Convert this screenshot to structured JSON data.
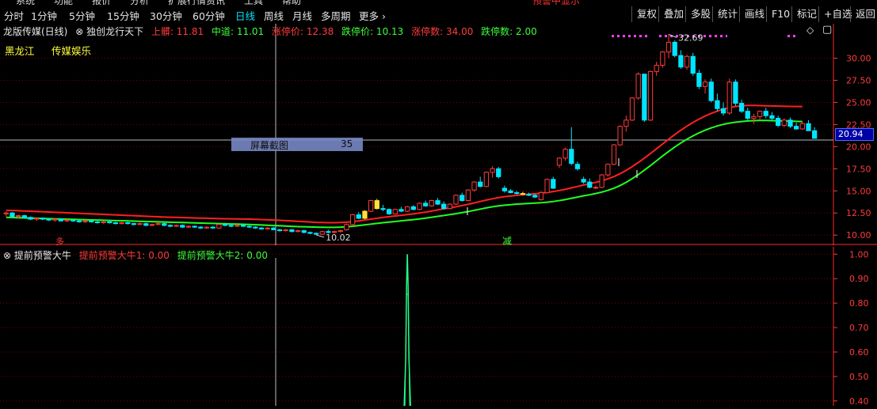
{
  "menu_strip": {
    "items": [
      "系统",
      "功能",
      "报价",
      "分析",
      "扩展行情",
      "资讯",
      "工具",
      "帮助"
    ],
    "alert": "预警中显示"
  },
  "periods": [
    {
      "label": "分时",
      "active": false
    },
    {
      "label": "1分钟",
      "active": false
    },
    {
      "label": "5分钟",
      "active": false
    },
    {
      "label": "15分钟",
      "active": false
    },
    {
      "label": "30分钟",
      "active": false
    },
    {
      "label": "60分钟",
      "active": false
    },
    {
      "label": "日线",
      "active": true
    },
    {
      "label": "周线",
      "active": false
    },
    {
      "label": "月线",
      "active": false
    },
    {
      "label": "多周期",
      "active": false
    },
    {
      "label": "更多 ›",
      "active": false
    }
  ],
  "right_buttons": [
    "复权",
    "叠加",
    "多股",
    "统计",
    "画线",
    "F10",
    "标记",
    "+自选",
    "返回"
  ],
  "main_title": {
    "stock": "龙版传媒(日线)",
    "indicator": "独创龙行天下",
    "upper": "上髒: 11.81",
    "middle": "中道: 11.01",
    "limit_up_price": "涨停价: 12.38",
    "limit_down_price": "跌停价: 10.13",
    "limit_up_count": "涨停数: 34.00",
    "limit_down_count": "跌停数: 2.00"
  },
  "tags": {
    "region": "黑龙江",
    "sector": "传媒娱乐"
  },
  "annotations": {
    "high": "32.69",
    "low": "10.02",
    "jian": "减",
    "mark_red": "多"
  },
  "screenshot_tip": {
    "label": "屏幕截图",
    "value": "35"
  },
  "current_price": "20.94",
  "price_axis": [
    "30.00",
    "27.50",
    "25.00",
    "22.50",
    "20.00",
    "17.50",
    "15.00",
    "12.50",
    "10.00"
  ],
  "indicator_title": {
    "name": "提前预警大牛",
    "line1": "提前预警大牛1: 0.00",
    "line2": "提前预警大牛2: 0.00"
  },
  "indicator_axis": [
    "1.00",
    "0.90",
    "0.80",
    "0.70",
    "0.60",
    "0.50",
    "0.40"
  ],
  "colors": {
    "up": "#ff3b3b",
    "down": "#00e5ff",
    "ma_red": "#ff2020",
    "ma_green": "#22ff22",
    "grid": "#7a0000",
    "magenta": "#ff40ff"
  },
  "chart_data": {
    "type": "candlestick",
    "ylim": [
      9.3,
      33.0
    ],
    "candles": [
      [
        12.4,
        12.7,
        12.1,
        12.5
      ],
      [
        12.5,
        12.6,
        12.0,
        12.1
      ],
      [
        12.1,
        12.3,
        11.9,
        12.2
      ],
      [
        12.2,
        12.3,
        11.9,
        12.0
      ],
      [
        12.0,
        12.1,
        11.7,
        11.8
      ],
      [
        11.8,
        12.0,
        11.6,
        11.9
      ],
      [
        11.9,
        12.0,
        11.7,
        11.8
      ],
      [
        11.8,
        11.9,
        11.6,
        11.7
      ],
      [
        11.7,
        11.9,
        11.5,
        11.8
      ],
      [
        11.8,
        11.9,
        11.6,
        11.6
      ],
      [
        11.6,
        11.8,
        11.5,
        11.7
      ],
      [
        11.7,
        11.8,
        11.5,
        11.6
      ],
      [
        11.6,
        11.7,
        11.4,
        11.5
      ],
      [
        11.5,
        11.7,
        11.4,
        11.6
      ],
      [
        11.6,
        11.7,
        11.4,
        11.5
      ],
      [
        11.5,
        11.6,
        11.3,
        11.4
      ],
      [
        11.4,
        11.6,
        11.3,
        11.5
      ],
      [
        11.5,
        11.7,
        11.3,
        11.4
      ],
      [
        11.4,
        11.5,
        11.2,
        11.3
      ],
      [
        11.3,
        11.5,
        11.2,
        11.4
      ],
      [
        11.4,
        11.5,
        11.2,
        11.3
      ],
      [
        11.3,
        11.4,
        11.1,
        11.2
      ],
      [
        11.2,
        11.4,
        11.1,
        11.3
      ],
      [
        11.3,
        11.4,
        11.0,
        11.1
      ],
      [
        11.1,
        11.3,
        11.0,
        11.2
      ],
      [
        11.2,
        11.4,
        11.1,
        11.3
      ],
      [
        11.3,
        11.4,
        11.0,
        11.1
      ],
      [
        11.1,
        11.2,
        10.9,
        11.0
      ],
      [
        11.0,
        11.2,
        10.9,
        11.1
      ],
      [
        11.1,
        11.2,
        10.8,
        10.9
      ],
      [
        10.9,
        11.1,
        10.8,
        11.0
      ],
      [
        11.0,
        11.1,
        10.8,
        10.9
      ],
      [
        10.9,
        11.0,
        10.7,
        10.8
      ],
      [
        10.8,
        11.0,
        10.7,
        10.9
      ],
      [
        10.9,
        11.0,
        10.7,
        10.8
      ],
      [
        10.8,
        11.3,
        10.7,
        11.2
      ],
      [
        11.2,
        11.4,
        11.0,
        11.1
      ],
      [
        11.1,
        11.3,
        10.9,
        11.0
      ],
      [
        11.0,
        11.2,
        10.9,
        11.1
      ],
      [
        11.1,
        11.2,
        10.9,
        11.0
      ],
      [
        11.0,
        11.1,
        10.8,
        10.9
      ],
      [
        10.9,
        11.0,
        10.7,
        10.8
      ],
      [
        10.8,
        10.9,
        10.6,
        10.7
      ],
      [
        10.7,
        10.9,
        10.6,
        10.8
      ],
      [
        10.8,
        10.9,
        10.6,
        10.6
      ],
      [
        10.6,
        10.7,
        10.4,
        10.5
      ],
      [
        10.5,
        10.7,
        10.4,
        10.6
      ],
      [
        10.6,
        10.7,
        10.3,
        10.4
      ],
      [
        10.4,
        10.6,
        10.3,
        10.5
      ],
      [
        10.5,
        10.6,
        10.2,
        10.3
      ],
      [
        10.3,
        10.4,
        10.1,
        10.2
      ],
      [
        10.2,
        10.3,
        10.02,
        10.1
      ],
      [
        10.1,
        10.5,
        10.0,
        10.4
      ],
      [
        10.4,
        10.6,
        10.2,
        10.3
      ],
      [
        10.3,
        10.5,
        10.2,
        10.4
      ],
      [
        10.4,
        10.6,
        10.3,
        10.5
      ],
      [
        10.6,
        11.3,
        10.5,
        11.2
      ],
      [
        11.2,
        12.4,
        11.1,
        12.3
      ],
      [
        12.3,
        12.6,
        11.8,
        11.9
      ],
      [
        11.9,
        12.8,
        11.8,
        12.7
      ],
      [
        12.7,
        14.0,
        12.6,
        13.9
      ],
      [
        13.9,
        14.1,
        12.9,
        13.0
      ],
      [
        13.0,
        13.4,
        12.7,
        12.9
      ],
      [
        12.9,
        13.0,
        12.3,
        12.4
      ],
      [
        12.4,
        13.0,
        12.3,
        12.9
      ],
      [
        12.9,
        13.2,
        12.6,
        12.7
      ],
      [
        12.7,
        13.3,
        12.6,
        13.2
      ],
      [
        13.2,
        13.4,
        12.8,
        12.9
      ],
      [
        12.9,
        13.7,
        12.8,
        13.6
      ],
      [
        13.6,
        13.9,
        13.2,
        13.3
      ],
      [
        13.3,
        14.0,
        13.2,
        13.9
      ],
      [
        13.9,
        14.2,
        13.4,
        13.5
      ],
      [
        13.5,
        13.8,
        12.9,
        13.0
      ],
      [
        13.0,
        13.6,
        12.9,
        13.5
      ],
      [
        13.5,
        14.6,
        13.4,
        14.5
      ],
      [
        14.5,
        14.8,
        13.8,
        13.9
      ],
      [
        13.9,
        15.2,
        13.8,
        15.1
      ],
      [
        15.1,
        16.1,
        14.9,
        16.0
      ],
      [
        16.0,
        16.6,
        15.4,
        15.5
      ],
      [
        15.5,
        17.2,
        15.4,
        17.1
      ],
      [
        17.1,
        17.8,
        16.5,
        17.5
      ],
      [
        17.5,
        17.7,
        16.4,
        16.6
      ],
      [
        15.3,
        15.6,
        14.8,
        15.0
      ],
      [
        15.0,
        15.2,
        14.7,
        14.8
      ],
      [
        14.8,
        15.0,
        14.6,
        14.7
      ],
      [
        14.7,
        14.9,
        14.5,
        14.6
      ],
      [
        14.6,
        14.8,
        14.4,
        14.5
      ],
      [
        14.5,
        14.7,
        14.2,
        14.3
      ],
      [
        14.0,
        15.0,
        13.9,
        14.8
      ],
      [
        14.8,
        16.4,
        14.7,
        16.3
      ],
      [
        16.3,
        16.6,
        15.2,
        15.3
      ],
      [
        17.9,
        18.8,
        17.6,
        18.7
      ],
      [
        18.7,
        19.9,
        18.4,
        19.7
      ],
      [
        19.7,
        22.2,
        17.9,
        18.1
      ],
      [
        18.0,
        18.3,
        17.3,
        17.5
      ],
      [
        16.3,
        16.6,
        15.8,
        16.0
      ],
      [
        16.0,
        16.4,
        15.3,
        15.4
      ],
      [
        15.4,
        15.6,
        15.2,
        15.4
      ],
      [
        15.4,
        16.9,
        15.3,
        16.8
      ],
      [
        16.8,
        18.1,
        16.6,
        18.0
      ],
      [
        18.0,
        20.3,
        17.9,
        20.2
      ],
      [
        20.2,
        22.4,
        20.1,
        22.3
      ],
      [
        22.3,
        23.5,
        21.7,
        23.0
      ],
      [
        23.0,
        25.6,
        22.9,
        25.5
      ],
      [
        25.5,
        28.4,
        25.3,
        28.2
      ],
      [
        28.2,
        26.8,
        22.8,
        23.0
      ],
      [
        23.0,
        28.6,
        22.9,
        28.5
      ],
      [
        28.5,
        29.6,
        28.0,
        29.2
      ],
      [
        29.2,
        30.8,
        28.9,
        30.7
      ],
      [
        30.7,
        32.69,
        30.0,
        31.8
      ],
      [
        31.8,
        32.0,
        30.1,
        30.3
      ],
      [
        30.3,
        30.9,
        28.8,
        29.0
      ],
      [
        29.0,
        30.4,
        28.7,
        30.2
      ],
      [
        30.2,
        30.6,
        28.0,
        28.3
      ],
      [
        28.3,
        28.7,
        26.5,
        26.8
      ],
      [
        26.8,
        27.6,
        26.0,
        27.3
      ],
      [
        27.3,
        27.7,
        25.0,
        25.2
      ],
      [
        25.2,
        26.0,
        24.0,
        24.3
      ],
      [
        24.3,
        25.0,
        23.5,
        23.8
      ],
      [
        23.8,
        27.7,
        23.6,
        27.3
      ],
      [
        27.3,
        27.6,
        24.6,
        24.9
      ],
      [
        24.9,
        25.3,
        23.8,
        24.0
      ],
      [
        24.0,
        24.4,
        23.0,
        23.2
      ],
      [
        23.2,
        23.7,
        22.6,
        23.4
      ],
      [
        23.4,
        24.1,
        23.0,
        24.0
      ],
      [
        24.0,
        24.4,
        23.2,
        23.5
      ],
      [
        23.5,
        23.9,
        23.0,
        23.2
      ],
      [
        23.2,
        23.5,
        22.2,
        22.4
      ],
      [
        22.4,
        23.2,
        22.2,
        23.0
      ],
      [
        23.0,
        23.3,
        22.1,
        22.3
      ],
      [
        22.3,
        22.7,
        21.9,
        22.0
      ],
      [
        22.0,
        22.8,
        21.9,
        22.6
      ],
      [
        22.6,
        23.0,
        21.8,
        21.8
      ],
      [
        21.8,
        22.2,
        20.9,
        20.94
      ]
    ],
    "ma_red": [
      12.8,
      12.78,
      12.75,
      12.72,
      12.7,
      12.67,
      12.64,
      12.61,
      12.58,
      12.55,
      12.52,
      12.49,
      12.46,
      12.43,
      12.4,
      12.37,
      12.34,
      12.31,
      12.28,
      12.25,
      12.22,
      12.19,
      12.16,
      12.13,
      12.1,
      12.07,
      12.04,
      12.02,
      12.0,
      11.98,
      11.96,
      11.94,
      11.92,
      11.9,
      11.88,
      11.86,
      11.85,
      11.84,
      11.83,
      11.82,
      11.8,
      11.78,
      11.76,
      11.73,
      11.7,
      11.67,
      11.64,
      11.6,
      11.56,
      11.52,
      11.48,
      11.44,
      11.42,
      11.4,
      11.4,
      11.42,
      11.46,
      11.52,
      11.6,
      11.7,
      11.8,
      11.9,
      12.0,
      12.08,
      12.16,
      12.24,
      12.32,
      12.4,
      12.5,
      12.6,
      12.72,
      12.84,
      12.96,
      13.08,
      13.2,
      13.34,
      13.48,
      13.64,
      13.8,
      13.96,
      14.1,
      14.24,
      14.34,
      14.42,
      14.5,
      14.56,
      14.62,
      14.68,
      14.74,
      14.82,
      14.92,
      15.04,
      15.18,
      15.34,
      15.5,
      15.66,
      15.8,
      15.96,
      16.14,
      16.36,
      16.62,
      16.94,
      17.32,
      17.74,
      18.2,
      18.7,
      19.22,
      19.76,
      20.3,
      20.84,
      21.36,
      21.86,
      22.32,
      22.74,
      23.12,
      23.46,
      23.76,
      24.02,
      24.24,
      24.42,
      24.54,
      24.62,
      24.66,
      24.66,
      24.64,
      24.62,
      24.6,
      24.58,
      24.56,
      24.55,
      24.54,
      24.54
    ],
    "ma_green": [
      12.0,
      11.98,
      11.96,
      11.94,
      11.92,
      11.9,
      11.88,
      11.86,
      11.84,
      11.82,
      11.8,
      11.78,
      11.76,
      11.74,
      11.72,
      11.7,
      11.68,
      11.66,
      11.64,
      11.62,
      11.6,
      11.58,
      11.56,
      11.54,
      11.52,
      11.5,
      11.48,
      11.46,
      11.44,
      11.42,
      11.4,
      11.38,
      11.36,
      11.34,
      11.32,
      11.3,
      11.28,
      11.26,
      11.24,
      11.22,
      11.2,
      11.17,
      11.14,
      11.11,
      11.08,
      11.05,
      11.02,
      10.99,
      10.96,
      10.94,
      10.92,
      10.9,
      10.89,
      10.88,
      10.88,
      10.9,
      10.94,
      11.0,
      11.08,
      11.16,
      11.24,
      11.32,
      11.4,
      11.47,
      11.54,
      11.61,
      11.68,
      11.75,
      11.83,
      11.92,
      12.02,
      12.12,
      12.22,
      12.32,
      12.42,
      12.54,
      12.66,
      12.8,
      12.94,
      13.08,
      13.2,
      13.3,
      13.38,
      13.44,
      13.5,
      13.54,
      13.58,
      13.62,
      13.66,
      13.72,
      13.8,
      13.9,
      14.02,
      14.16,
      14.3,
      14.44,
      14.56,
      14.7,
      14.86,
      15.06,
      15.3,
      15.6,
      15.96,
      16.38,
      16.84,
      17.34,
      17.86,
      18.4,
      18.94,
      19.46,
      19.96,
      20.42,
      20.84,
      21.22,
      21.56,
      21.86,
      22.12,
      22.34,
      22.52,
      22.66,
      22.76,
      22.84,
      22.9,
      22.94,
      22.96,
      22.96,
      22.94,
      22.92,
      22.9,
      22.88,
      22.86,
      22.84
    ],
    "highlight_candles": {
      "yellow": [
        59,
        61,
        85
      ],
      "magenta_dots_y": 32.5
    }
  },
  "indicator_data": {
    "type": "line",
    "ylim": [
      0.38,
      1.03
    ],
    "spike_index": 66,
    "spike_value": 1.0
  }
}
